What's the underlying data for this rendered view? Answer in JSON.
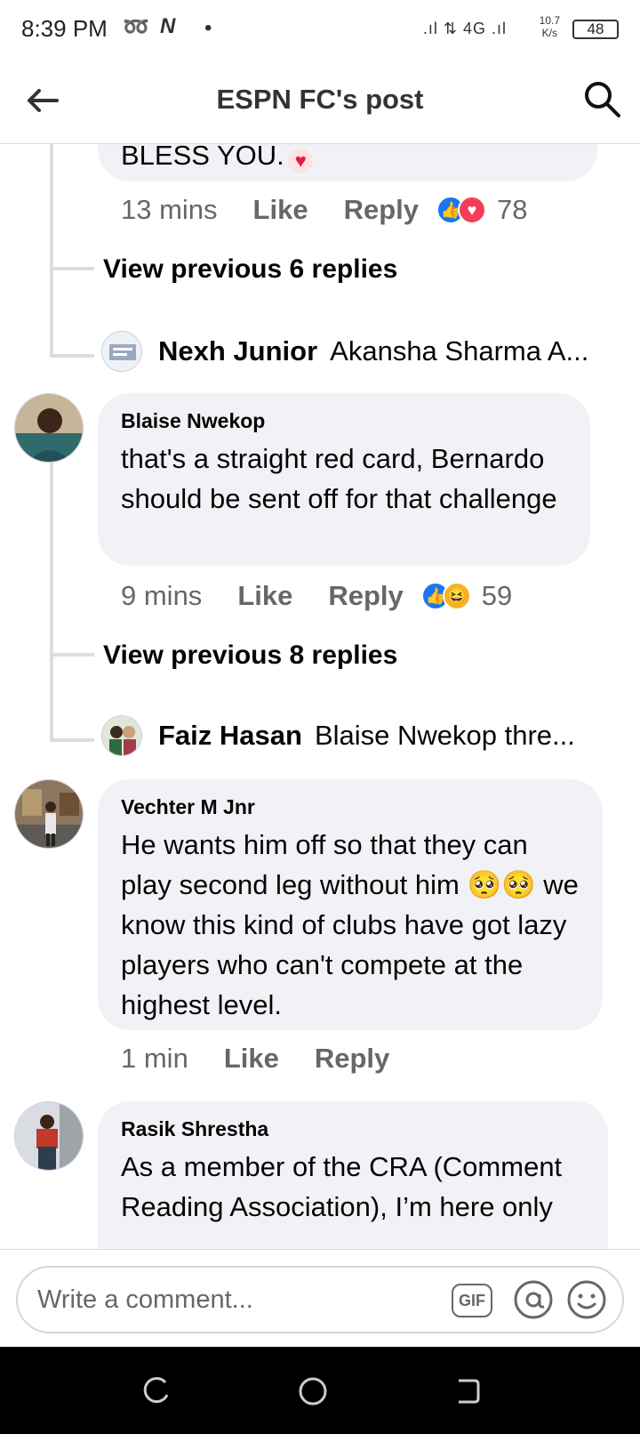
{
  "status": {
    "time": "8:39 PM",
    "net_speed_top": "10.7",
    "net_speed_bottom": "K/s",
    "net_type": "4G",
    "battery": "48"
  },
  "header": {
    "title": "ESPN FC's post",
    "back_icon": "arrow-left-icon",
    "search_icon": "search-icon"
  },
  "comments": [
    {
      "text_partial": "BLESS YOU.",
      "time": "13 mins",
      "like": "Like",
      "reply": "Reply",
      "reactions": [
        "like",
        "love"
      ],
      "count": "78"
    },
    {
      "name": "Blaise Nwekop",
      "text": "that's a straight red card, Bernardo should be sent off for that challenge",
      "time": "9 mins",
      "like": "Like",
      "reply": "Reply",
      "reactions": [
        "like",
        "haha"
      ],
      "count": "59"
    },
    {
      "name": "Vechter M Jnr",
      "text": "He wants him off so that they can play second leg without him 🥺🥺 we know this kind of clubs have got lazy players who can't compete at the highest level.",
      "time": "1 min",
      "like": "Like",
      "reply": "Reply"
    },
    {
      "name": "Rasik Shrestha",
      "text": "As a member of the CRA (Comment Reading Association), I’m here only"
    }
  ],
  "view_prev": [
    "View previous 6 replies",
    "View previous 8 replies"
  ],
  "replies": [
    {
      "name": "Nexh Junior",
      "snippet": "Akansha Sharma A..."
    },
    {
      "name": "Faiz Hasan",
      "snippet": "Blaise Nwekop thre..."
    }
  ],
  "composer": {
    "placeholder": "Write a comment...",
    "gif": "GIF"
  }
}
